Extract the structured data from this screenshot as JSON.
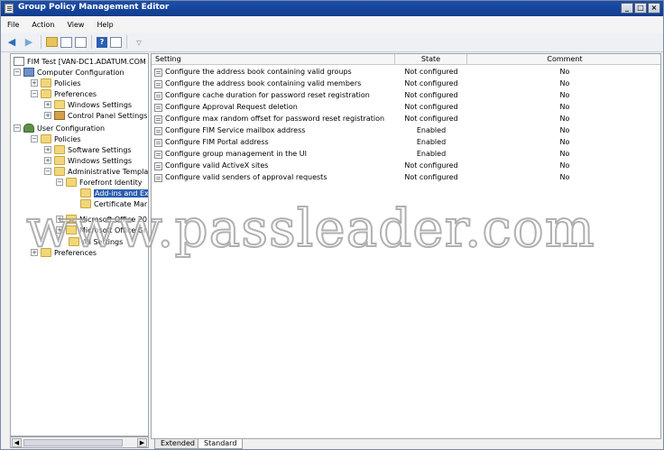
{
  "window": {
    "title": "Group Policy Management Editor",
    "controls": [
      "_",
      "□",
      "×"
    ]
  },
  "menu": [
    "File",
    "Action",
    "View",
    "Help"
  ],
  "tree": [
    {
      "label": "FIM Test [VAN-DC1.ADATUM.COM",
      "icon": "gpo-icon",
      "exp": ""
    },
    {
      "label": "Computer Configuration",
      "icon": "computer-icon",
      "exp": "−"
    },
    {
      "label": "Policies",
      "icon": "folder-icon",
      "exp": "+"
    },
    {
      "label": "Preferences",
      "icon": "folder-icon",
      "exp": "−"
    },
    {
      "label": "Windows Settings",
      "icon": "folder-icon",
      "exp": "+"
    },
    {
      "label": "Control Panel Settings",
      "icon": "control-panel-icon",
      "exp": "+"
    },
    {
      "label": "User Configuration",
      "icon": "user-icon",
      "exp": "−"
    },
    {
      "label": "Policies",
      "icon": "folder-icon",
      "exp": "−"
    },
    {
      "label": "Software Settings",
      "icon": "folder-icon",
      "exp": "+"
    },
    {
      "label": "Windows Settings",
      "icon": "folder-icon",
      "exp": "+"
    },
    {
      "label": "Administrative Templat",
      "icon": "folder-icon",
      "exp": "−"
    },
    {
      "label": "Forefront Identity",
      "icon": "folder-icon",
      "exp": "−"
    },
    {
      "label": "Add-ins and Ex",
      "icon": "folder-icon",
      "exp": "",
      "selected": true
    },
    {
      "label": "Certificate Mar",
      "icon": "folder-icon",
      "exp": ""
    },
    {
      "label": "Microsoft Office 20",
      "icon": "folder-icon",
      "exp": "+"
    },
    {
      "label": "Microsoft Office Gr",
      "icon": "folder-icon",
      "exp": "+"
    },
    {
      "label": "All Settings",
      "icon": "folder-icon",
      "exp": ""
    },
    {
      "label": "Preferences",
      "icon": "folder-icon",
      "exp": "+"
    }
  ],
  "columns": {
    "setting": "Setting",
    "state": "State",
    "comment": "Comment"
  },
  "rows": [
    {
      "setting": "Configure the address book containing valid groups",
      "state": "Not configured",
      "comment": "No"
    },
    {
      "setting": "Configure the address book containing valid members",
      "state": "Not configured",
      "comment": "No"
    },
    {
      "setting": "Configure cache duration for password reset registration",
      "state": "Not configured",
      "comment": "No"
    },
    {
      "setting": "Configure Approval Request deletion",
      "state": "Not configured",
      "comment": "No"
    },
    {
      "setting": "Configure max random offset for password reset registration",
      "state": "Not configured",
      "comment": "No"
    },
    {
      "setting": "Configure FIM Service mailbox address",
      "state": "Enabled",
      "comment": "No"
    },
    {
      "setting": "Configure FIM Portal address",
      "state": "Enabled",
      "comment": "No"
    },
    {
      "setting": "Configure group management in the UI",
      "state": "Enabled",
      "comment": "No"
    },
    {
      "setting": "Configure valid ActiveX sites",
      "state": "Not configured",
      "comment": "No"
    },
    {
      "setting": "Configure valid senders of approval requests",
      "state": "Not configured",
      "comment": "No"
    }
  ],
  "tabs": [
    "Extended",
    "Standard"
  ],
  "watermark": "www.passleader.com"
}
